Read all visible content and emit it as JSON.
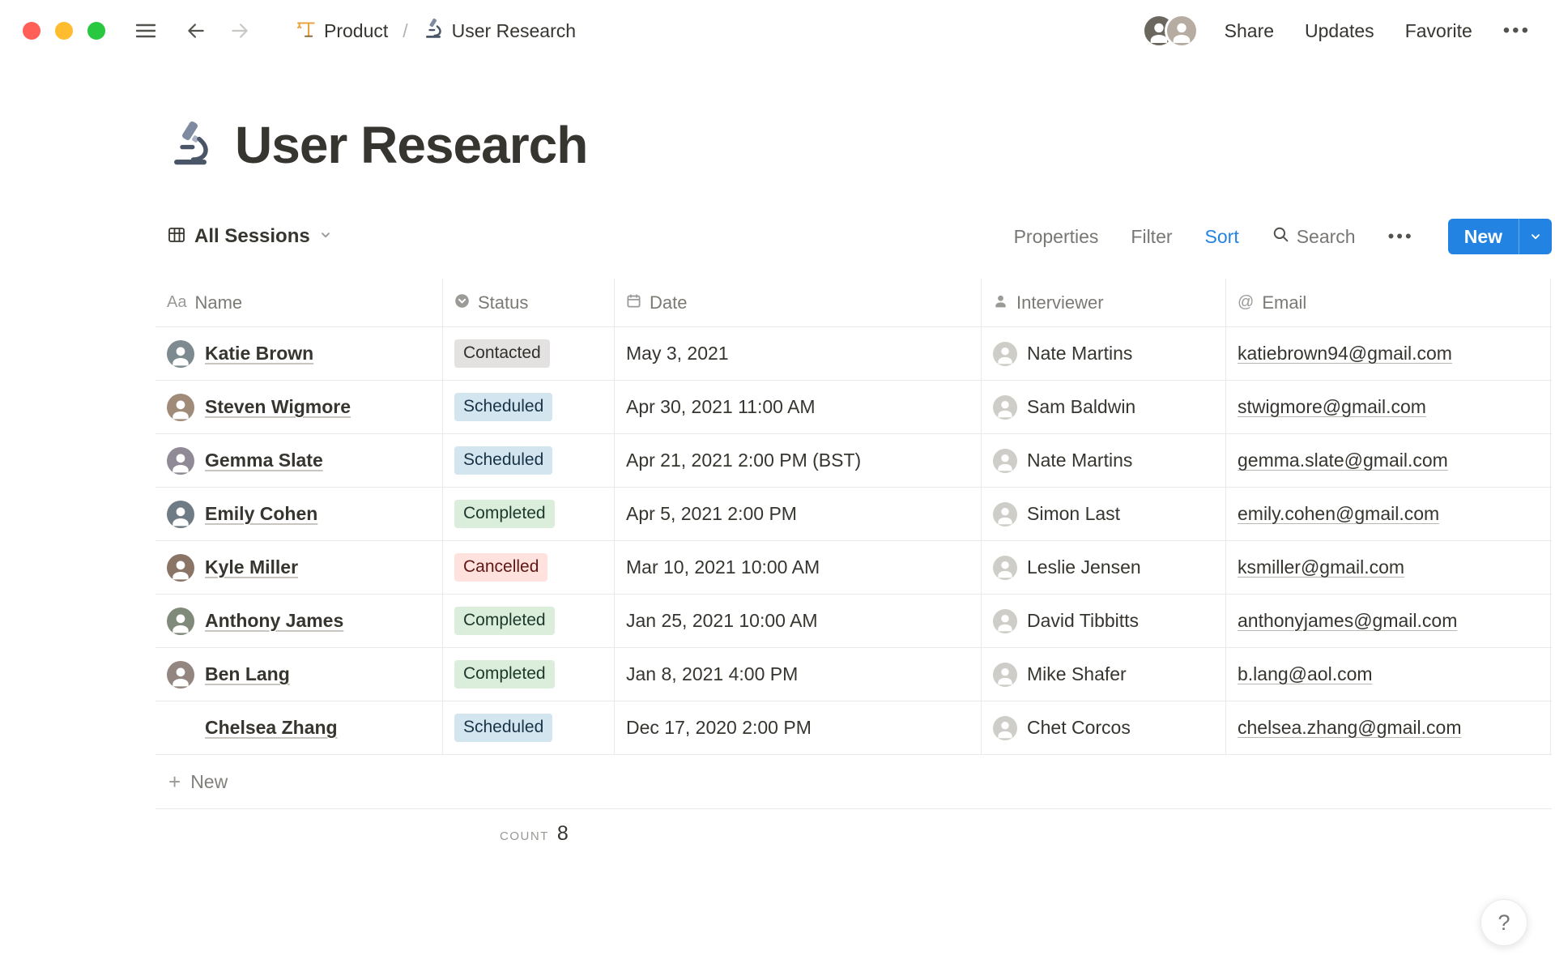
{
  "window": {
    "breadcrumb": {
      "product": "Product",
      "current": "User Research",
      "separator": "/"
    },
    "actions": {
      "share": "Share",
      "updates": "Updates",
      "favorite": "Favorite",
      "more": "•••"
    }
  },
  "page": {
    "icon": "microscope-icon",
    "title": "User Research"
  },
  "toolbar": {
    "view": "All Sessions",
    "properties": "Properties",
    "filter": "Filter",
    "sort": "Sort",
    "search": "Search",
    "more": "•••",
    "new_label": "New"
  },
  "table": {
    "columns": [
      {
        "id": "name",
        "label": "Name",
        "icon": "text-icon",
        "glyph": "Aa"
      },
      {
        "id": "status",
        "label": "Status",
        "icon": "select-icon"
      },
      {
        "id": "date",
        "label": "Date",
        "icon": "calendar-icon"
      },
      {
        "id": "interviewer",
        "label": "Interviewer",
        "icon": "person-icon"
      },
      {
        "id": "email",
        "label": "Email",
        "icon": "at-icon",
        "glyph": "@"
      }
    ],
    "rows": [
      {
        "name": "Katie Brown",
        "status": "Contacted",
        "status_key": "contacted",
        "date": "May 3, 2021",
        "interviewer": "Nate Martins",
        "email": "katiebrown94@gmail.com"
      },
      {
        "name": "Steven Wigmore",
        "status": "Scheduled",
        "status_key": "scheduled",
        "date": "Apr 30, 2021 11:00 AM",
        "interviewer": "Sam Baldwin",
        "email": "stwigmore@gmail.com"
      },
      {
        "name": "Gemma Slate",
        "status": "Scheduled",
        "status_key": "scheduled",
        "date": "Apr 21, 2021 2:00 PM (BST)",
        "interviewer": "Nate Martins",
        "email": "gemma.slate@gmail.com"
      },
      {
        "name": "Emily Cohen",
        "status": "Completed",
        "status_key": "completed",
        "date": "Apr 5, 2021 2:00 PM",
        "interviewer": "Simon Last",
        "email": "emily.cohen@gmail.com"
      },
      {
        "name": "Kyle Miller",
        "status": "Cancelled",
        "status_key": "cancelled",
        "date": "Mar 10, 2021 10:00 AM",
        "interviewer": "Leslie Jensen",
        "email": "ksmiller@gmail.com"
      },
      {
        "name": "Anthony James",
        "status": "Completed",
        "status_key": "completed",
        "date": "Jan 25, 2021 10:00 AM",
        "interviewer": "David Tibbitts",
        "email": "anthonyjames@gmail.com"
      },
      {
        "name": "Ben Lang",
        "status": "Completed",
        "status_key": "completed",
        "date": "Jan 8, 2021 4:00 PM",
        "interviewer": "Mike Shafer",
        "email": "b.lang@aol.com"
      },
      {
        "name": "Chelsea Zhang",
        "status": "Scheduled",
        "status_key": "scheduled",
        "date": "Dec 17, 2020 2:00 PM",
        "interviewer": "Chet Corcos",
        "email": "chelsea.zhang@gmail.com"
      }
    ],
    "footer": {
      "new_label": "New",
      "count_label": "COUNT",
      "count_value": "8"
    }
  },
  "help": {
    "label": "?"
  },
  "colors": {
    "accent": "#2383E2",
    "traffic_red": "#FF5F57",
    "traffic_yellow": "#FEBC2E",
    "traffic_green": "#28C840",
    "badge_contacted_bg": "#E3E2E0",
    "badge_scheduled_bg": "#D3E5EF",
    "badge_completed_bg": "#DBEDDB",
    "badge_cancelled_bg": "#FFE2DD"
  }
}
